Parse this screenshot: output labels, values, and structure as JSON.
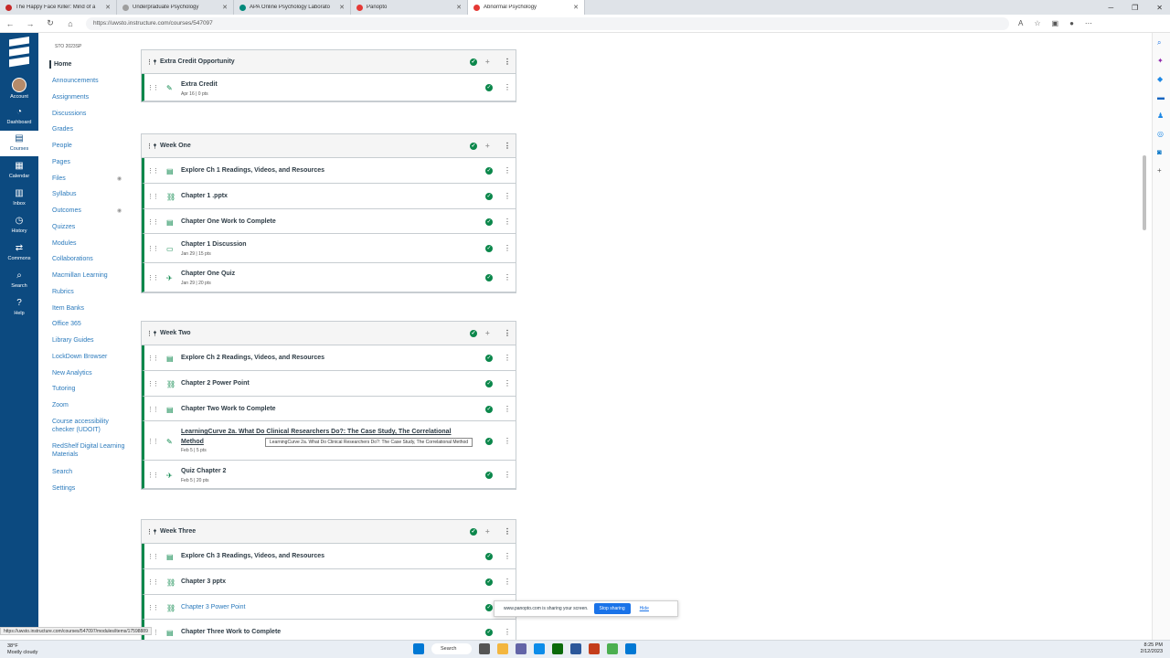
{
  "browser": {
    "tabs": [
      {
        "label": "The Happy Face Killer: Mind of a",
        "color": "#c62828"
      },
      {
        "label": "Underpraduate Psychology",
        "color": "#9e9e9e"
      },
      {
        "label": "APA Online Psychology Laborato",
        "color": "#00897b"
      },
      {
        "label": "Panopto",
        "color": "#e53935"
      },
      {
        "label": "Abnormal Psychology",
        "color": "#e53935",
        "active": true
      }
    ],
    "url": "https://uwsto.instructure.com/courses/547097"
  },
  "global_nav": {
    "items": [
      {
        "label": "Account",
        "icon": "avatar"
      },
      {
        "label": "Dashboard",
        "icon": "dashboard-icon"
      },
      {
        "label": "Courses",
        "icon": "courses-icon",
        "active": true
      },
      {
        "label": "Calendar",
        "icon": "calendar-icon"
      },
      {
        "label": "Inbox",
        "icon": "inbox-icon"
      },
      {
        "label": "History",
        "icon": "history-icon"
      },
      {
        "label": "Commons",
        "icon": "commons-icon"
      },
      {
        "label": "Search",
        "icon": "search-icon"
      },
      {
        "label": "Help",
        "icon": "help-icon"
      }
    ]
  },
  "course_nav": {
    "term": "STO 2023SP",
    "items": [
      "Home",
      "Announcements",
      "Assignments",
      "Discussions",
      "Grades",
      "People",
      "Pages",
      "Files",
      "Syllabus",
      "Outcomes",
      "Quizzes",
      "Modules",
      "Collaborations",
      "Macmillan Learning",
      "Rubrics",
      "Item Banks",
      "Office 365",
      "Library Guides",
      "LockDown Browser",
      "New Analytics",
      "Tutoring",
      "Zoom",
      "Course accessibility checker (UDOIT)",
      "RedShelf Digital Learning Materials",
      "Search",
      "Settings"
    ]
  },
  "modules": [
    {
      "title": "Extra Credit Opportunity",
      "items": [
        {
          "name": "Extra Credit",
          "meta": "Apr 16  |  0 pts",
          "type": "assignment"
        }
      ]
    },
    {
      "title": "Week One",
      "items": [
        {
          "name": "Explore Ch 1 Readings, Videos, and Resources",
          "meta": "",
          "type": "page"
        },
        {
          "name": "Chapter 1 .pptx",
          "meta": "",
          "type": "attachment"
        },
        {
          "name": "Chapter One Work to Complete",
          "meta": "",
          "type": "page"
        },
        {
          "name": "Chapter 1 Discussion",
          "meta": "Jan 29  |  15 pts",
          "type": "discussion"
        },
        {
          "name": "Chapter One Quiz",
          "meta": "Jan 29  |  20 pts",
          "type": "quiz"
        }
      ]
    },
    {
      "title": "Week Two",
      "items": [
        {
          "name": "Explore Ch 2 Readings, Videos, and Resources",
          "meta": "",
          "type": "page"
        },
        {
          "name": "Chapter 2 Power Point",
          "meta": "",
          "type": "attachment"
        },
        {
          "name": "Chapter Two Work to Complete",
          "meta": "",
          "type": "page"
        },
        {
          "name": "LearningCurve 2a. What Do Clinical Researchers Do?: The Case Study, The Correlational Method",
          "meta": "Feb 5  |  5 pts",
          "type": "assignment"
        },
        {
          "name": "Quiz Chapter 2",
          "meta": "Feb 5  |  20 pts",
          "type": "quiz"
        }
      ]
    },
    {
      "title": "Week Three",
      "items": [
        {
          "name": "Explore Ch 3 Readings, Videos, and Resources",
          "meta": "",
          "type": "page"
        },
        {
          "name": "Chapter 3 pptx",
          "meta": "",
          "type": "attachment"
        },
        {
          "name": "Chapter 3 Power Point",
          "meta": "",
          "type": "link"
        },
        {
          "name": "Chapter Three Work to Complete",
          "meta": "",
          "type": "page"
        }
      ]
    }
  ],
  "tooltip": "LearningCurve 2a. What Do Clinical Researchers Do?: The Case Study, The Correlational Method",
  "share_bar": {
    "message": "www.panopto.com is sharing your screen.",
    "stop": "Stop sharing",
    "hide": "Hide"
  },
  "status_url": "https://uwsto.instructure.com/courses/547097/modules/items/17598889",
  "taskbar": {
    "weather_temp": "38°F",
    "weather_desc": "Mostly cloudy",
    "search": "Search",
    "time": "8:25 PM",
    "date": "2/12/2023"
  }
}
